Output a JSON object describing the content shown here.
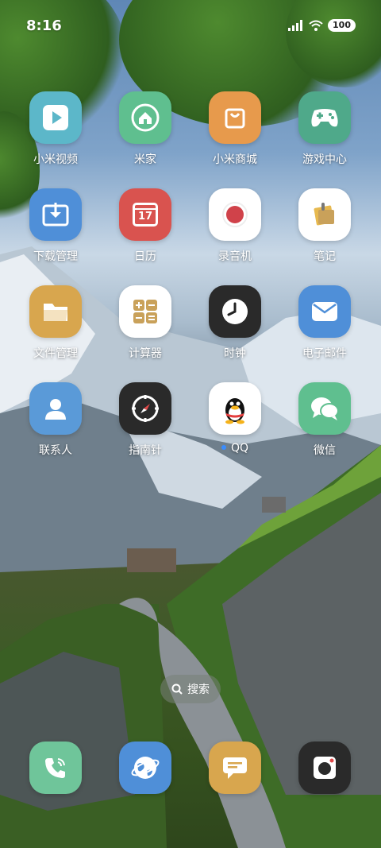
{
  "status_bar": {
    "time": "8:16",
    "battery": "100"
  },
  "apps": [
    {
      "label": "小米视频",
      "icon": "play-icon",
      "color": "#5cb7c9"
    },
    {
      "label": "米家",
      "icon": "home-icon",
      "color": "#5fbf8f"
    },
    {
      "label": "小米商城",
      "icon": "shopping-bag-icon",
      "color": "#e79a4c"
    },
    {
      "label": "游戏中心",
      "icon": "gamepad-icon",
      "color": "#4fa98a"
    },
    {
      "label": "下载管理",
      "icon": "download-icon",
      "color": "#4f8fd8"
    },
    {
      "label": "日历",
      "icon": "calendar-icon",
      "color": "#d9534f",
      "badge": "17"
    },
    {
      "label": "录音机",
      "icon": "record-icon",
      "color": "#ffffff"
    },
    {
      "label": "笔记",
      "icon": "notes-icon",
      "color": "#ffffff"
    },
    {
      "label": "文件管理",
      "icon": "folder-icon",
      "color": "#d8a64e"
    },
    {
      "label": "计算器",
      "icon": "calculator-icon",
      "color": "#ffffff"
    },
    {
      "label": "时钟",
      "icon": "clock-icon",
      "color": "#2a2a2a"
    },
    {
      "label": "电子邮件",
      "icon": "mail-icon",
      "color": "#4f8fd8"
    },
    {
      "label": "联系人",
      "icon": "contact-icon",
      "color": "#5a9ad8"
    },
    {
      "label": "指南针",
      "icon": "compass-icon",
      "color": "#2a2a2a"
    },
    {
      "label": "QQ",
      "icon": "qq-penguin-icon",
      "color": "#ffffff",
      "new_dot": true
    },
    {
      "label": "微信",
      "icon": "chat-bubbles-icon",
      "color": "#5fbf8f"
    }
  ],
  "search": {
    "label": "搜索"
  },
  "dock": [
    {
      "icon": "phone-icon",
      "color": "#6fc59a"
    },
    {
      "icon": "browser-icon",
      "color": "#4f8fd8"
    },
    {
      "icon": "message-icon",
      "color": "#d8a64e"
    },
    {
      "icon": "camera-icon",
      "color": "#2a2a2a"
    }
  ]
}
